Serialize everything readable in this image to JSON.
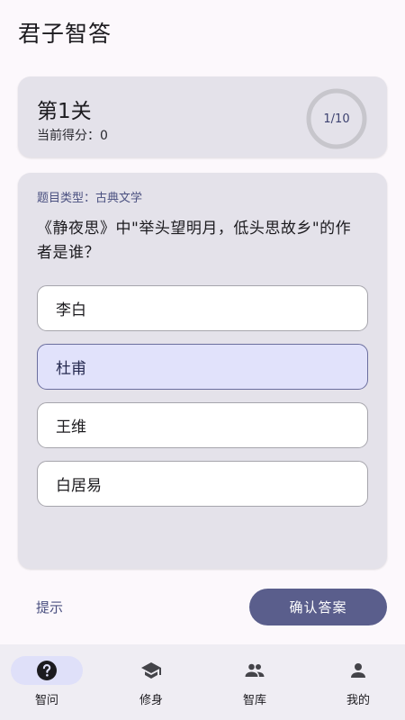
{
  "app": {
    "title": "君子智答"
  },
  "level": {
    "title": "第1关",
    "score_label": "当前得分：",
    "score_value": "0",
    "progress_text": "1/10",
    "progress_fraction": 0.1
  },
  "question": {
    "type_label": "题目类型：",
    "type_value": "古典文学",
    "text": "《静夜思》中\"举头望明月，低头思故乡\"的作者是谁？",
    "options": [
      {
        "label": "李白",
        "selected": false
      },
      {
        "label": "杜甫",
        "selected": true
      },
      {
        "label": "王维",
        "selected": false
      },
      {
        "label": "白居易",
        "selected": false
      }
    ]
  },
  "actions": {
    "hint_label": "提示",
    "confirm_label": "确认答案"
  },
  "nav": {
    "items": [
      {
        "label": "智问",
        "icon": "help-circle-icon",
        "active": true
      },
      {
        "label": "修身",
        "icon": "graduation-cap-icon",
        "active": false
      },
      {
        "label": "智库",
        "icon": "people-icon",
        "active": false
      },
      {
        "label": "我的",
        "icon": "person-icon",
        "active": false
      }
    ]
  },
  "colors": {
    "accent": "#5a5e8c",
    "card_bg": "#e4e2ea",
    "selected_option_bg": "#e1e2fb",
    "nav_active_pill": "#dfe0f9"
  }
}
